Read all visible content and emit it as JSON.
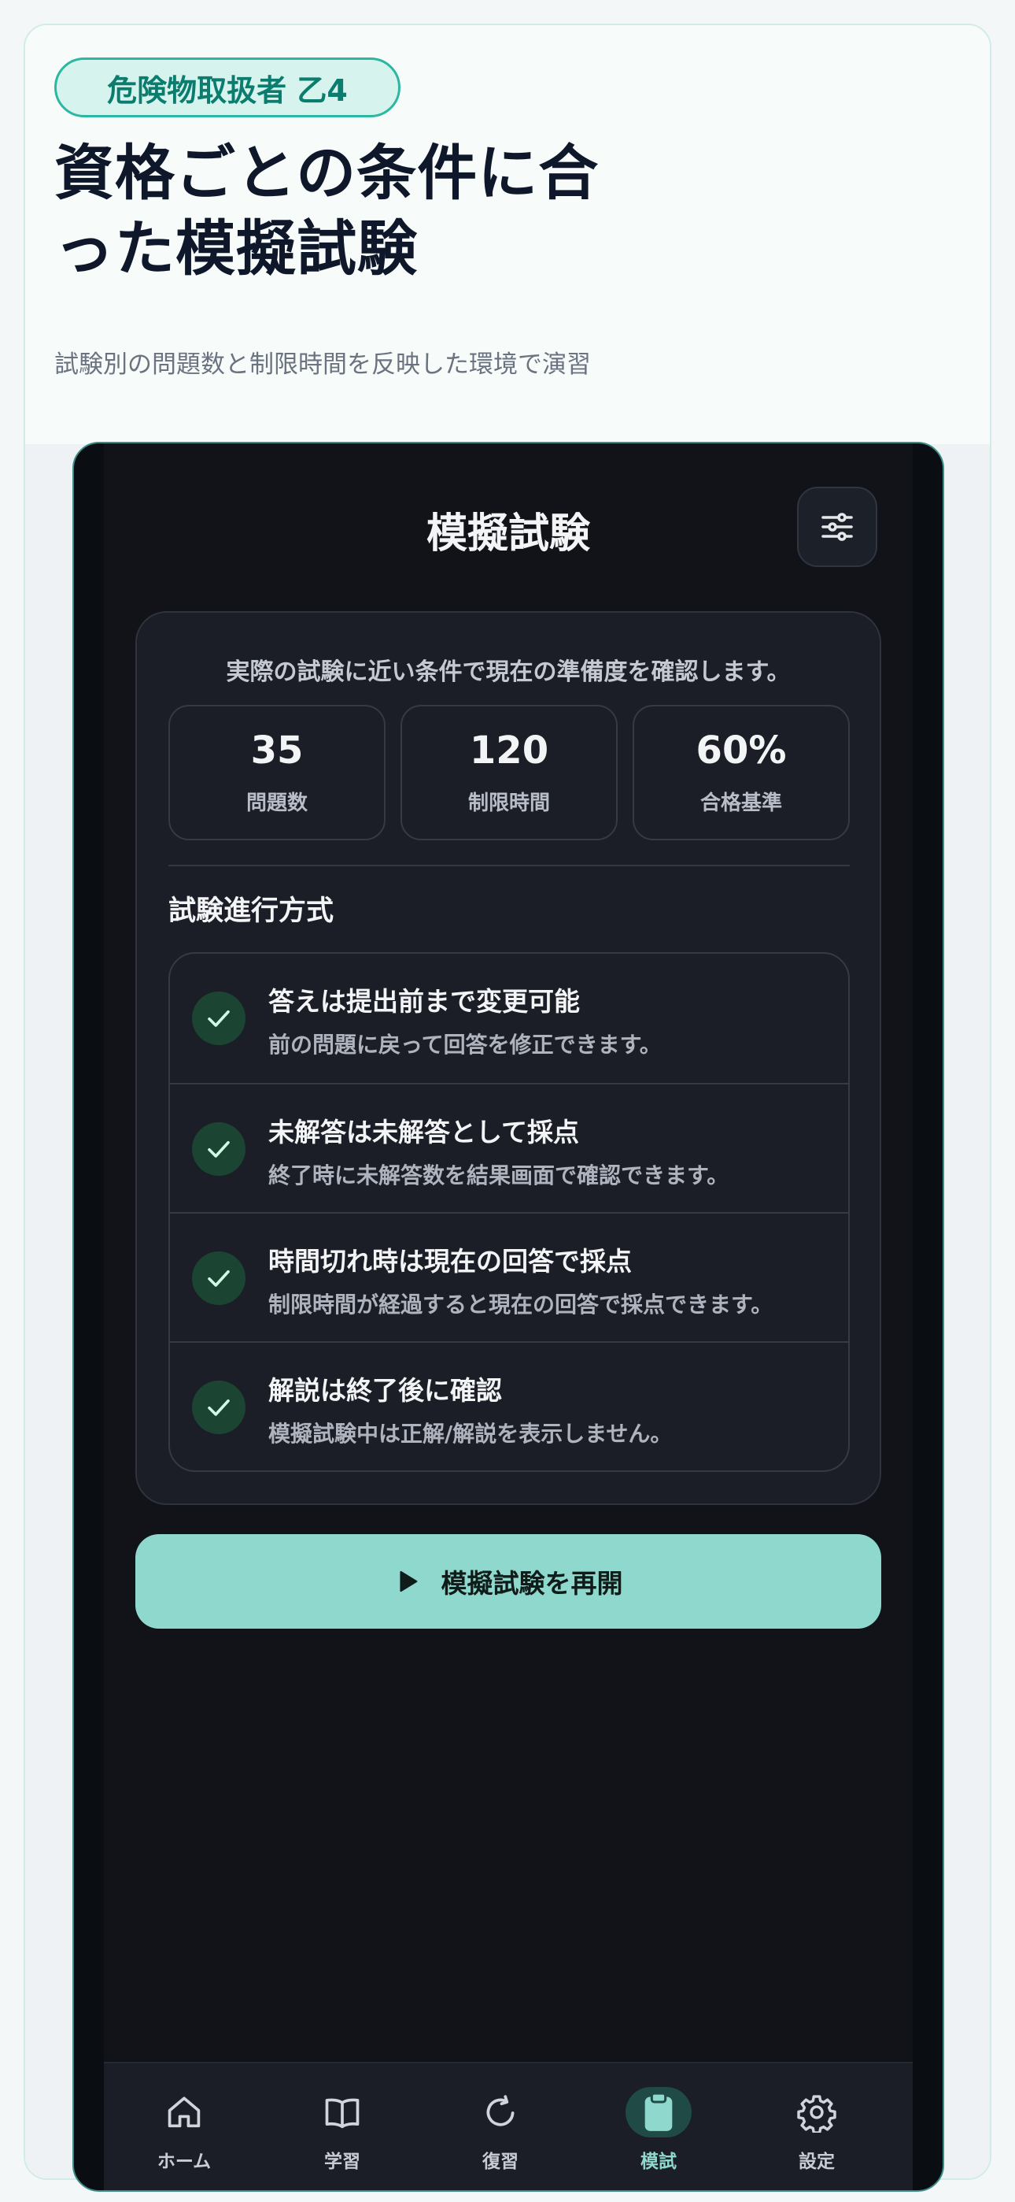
{
  "hero": {
    "tag": "危険物取扱者 乙4",
    "title": "資格ごとの条件に合った模擬試験",
    "subtitle": "試験別の問題数と制限時間を反映した環境で演習"
  },
  "screen": {
    "title": "模擬試験",
    "settings_icon": "sliders-icon",
    "lead": "実際の試験に近い条件で現在の準備度を確認します。",
    "stats": [
      {
        "value": "35",
        "label": "問題数"
      },
      {
        "value": "120",
        "label": "制限時間"
      },
      {
        "value": "60%",
        "label": "合格基準"
      }
    ],
    "rules_title": "試験進行方式",
    "rules": [
      {
        "title": "答えは提出前まで変更可能",
        "desc": "前の問題に戻って回答を修正できます。"
      },
      {
        "title": "未解答は未解答として採点",
        "desc": "終了時に未解答数を結果画面で確認できます。"
      },
      {
        "title": "時間切れ時は現在の回答で採点",
        "desc": "制限時間が経過すると現在の回答で採点できます。"
      },
      {
        "title": "解説は終了後に確認",
        "desc": "模擬試験中は正解/解説を表示しません。"
      }
    ],
    "resume_label": "模擬試験を再開"
  },
  "tabbar": {
    "items": [
      {
        "label": "ホーム",
        "icon": "home-icon"
      },
      {
        "label": "学習",
        "icon": "book-icon"
      },
      {
        "label": "復習",
        "icon": "refresh-icon"
      },
      {
        "label": "模試",
        "icon": "clipboard-icon",
        "active": true
      },
      {
        "label": "設定",
        "icon": "gear-icon"
      }
    ]
  },
  "colors": {
    "accent": "#8fd8cd",
    "tag_text": "#0b7d6e",
    "screen_bg": "#111318",
    "card_bg": "#1b1e26"
  }
}
